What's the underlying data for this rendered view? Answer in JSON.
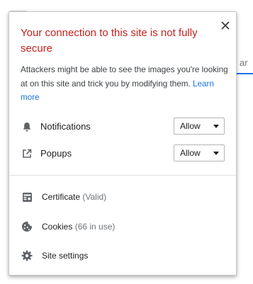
{
  "background": {
    "right_tab_fragment": "ar"
  },
  "popup": {
    "title": "Your connection to this site is not fully secure",
    "description": "Attackers might be able to see the images you're looking at on this site and trick you by modifying them.",
    "learn_more_label": "Learn more",
    "close_icon": "close-icon",
    "colors": {
      "title": "#c5221f",
      "link": "#1a73e8",
      "text": "#202124",
      "secondary_text": "#70757a"
    },
    "permissions": [
      {
        "label": "Notifications",
        "icon": "bell-icon",
        "value": "Allow"
      },
      {
        "label": "Popups",
        "icon": "external-link-icon",
        "value": "Allow"
      }
    ],
    "links": [
      {
        "label": "Certificate",
        "sub": "(Valid)",
        "icon": "certificate-icon"
      },
      {
        "label": "Cookies",
        "sub": "(66 in use)",
        "icon": "cookie-icon"
      },
      {
        "label": "Site settings",
        "sub": "",
        "icon": "gear-icon"
      }
    ]
  }
}
